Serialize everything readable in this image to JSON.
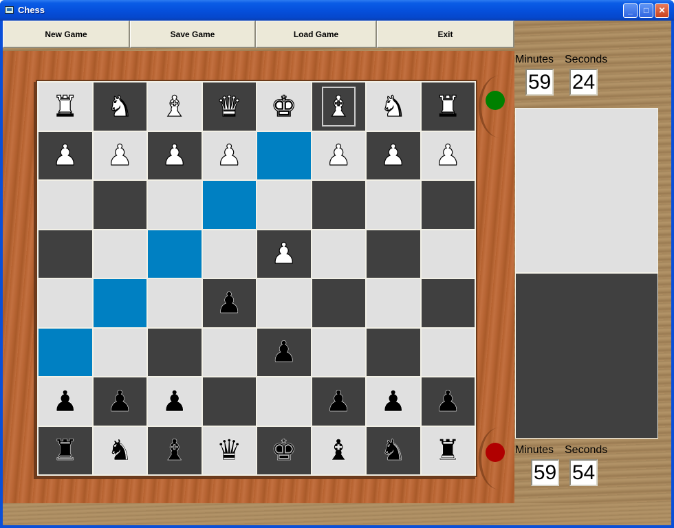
{
  "window": {
    "title": "Chess",
    "controls": {
      "minimize": "_",
      "maximize": "□",
      "close": "✕"
    }
  },
  "toolbar": {
    "new_game": "New Game",
    "save_game": "Save Game",
    "load_game": "Load Game",
    "exit": "Exit"
  },
  "board": {
    "rows": [
      [
        "wR",
        "wN",
        "wB",
        "wQ",
        "wK",
        "wB",
        "wN",
        "wR"
      ],
      [
        "wP",
        "wP",
        "wP",
        "wP",
        "",
        "wP",
        "wP",
        "wP"
      ],
      [
        "",
        "",
        "",
        "",
        "",
        "",
        "",
        ""
      ],
      [
        "",
        "",
        "",
        "",
        "wP",
        "",
        "",
        ""
      ],
      [
        "",
        "",
        "",
        "bP",
        "",
        "",
        "",
        ""
      ],
      [
        "",
        "",
        "",
        "",
        "bP",
        "",
        "",
        ""
      ],
      [
        "bP",
        "bP",
        "bP",
        "",
        "",
        "bP",
        "bP",
        "bP"
      ],
      [
        "bR",
        "bN",
        "bB",
        "bQ",
        "bK",
        "bB",
        "bN",
        "bR"
      ]
    ],
    "highlighted": [
      [
        1,
        4
      ],
      [
        2,
        3
      ],
      [
        3,
        2
      ],
      [
        4,
        1
      ],
      [
        5,
        0
      ]
    ],
    "selected": [
      0,
      5
    ],
    "glyphs": {
      "K": "♚",
      "Q": "♛",
      "R": "♜",
      "B": "♝",
      "N": "♞",
      "P": "♟"
    }
  },
  "turn_indicators": {
    "top": {
      "color": "#008000",
      "meaning": "active"
    },
    "bottom": {
      "color": "#b00000",
      "meaning": "inactive"
    }
  },
  "timers": {
    "top": {
      "minutes_label": "Minutes",
      "seconds_label": "Seconds",
      "minutes": "59",
      "seconds": "24"
    },
    "bottom": {
      "minutes_label": "Minutes",
      "seconds_label": "Seconds",
      "minutes": "59",
      "seconds": "54"
    }
  },
  "captured_panels": {
    "top_color": "#e0e0e0",
    "bottom_color": "#404040"
  }
}
